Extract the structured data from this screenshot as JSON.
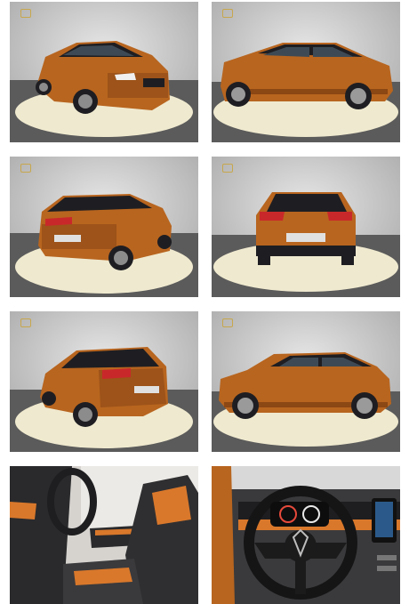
{
  "gallery": {
    "watermark_text": "",
    "colors": {
      "body_orange": "#b8651f",
      "body_dark": "#7a3d10",
      "roof_black": "#1e1e22",
      "studio_wall": "#cfcfcf",
      "turntable": "#efe9cf",
      "interior_dark": "#2a2a2c",
      "interior_orange": "#d9782b"
    },
    "photos": [
      {
        "name": "front-left-three-quarter-photo",
        "view": "front-left"
      },
      {
        "name": "side-right-photo",
        "view": "side-right"
      },
      {
        "name": "rear-left-three-quarter-photo",
        "view": "rear-left"
      },
      {
        "name": "rear-photo",
        "view": "rear"
      },
      {
        "name": "rear-right-three-quarter-photo",
        "view": "rear-right"
      },
      {
        "name": "side-left-photo",
        "view": "side-left"
      },
      {
        "name": "interior-front-seats-photo",
        "view": "interior-seats"
      },
      {
        "name": "dashboard-steering-wheel-photo",
        "view": "dashboard"
      }
    ]
  }
}
